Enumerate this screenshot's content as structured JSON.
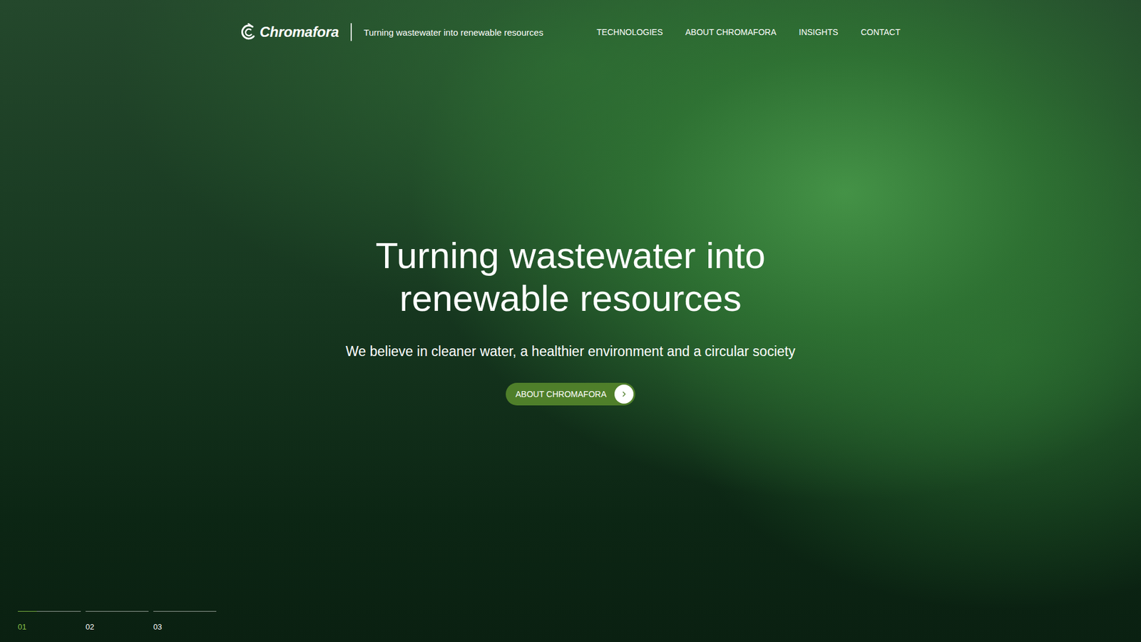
{
  "header": {
    "logo": "Chromafora",
    "tagline": "Turning wastewater into renewable resources"
  },
  "nav": [
    {
      "label": "TECHNOLOGIES"
    },
    {
      "label": "ABOUT CHROMAFORA"
    },
    {
      "label": "INSIGHTS"
    },
    {
      "label": "CONTACT"
    }
  ],
  "hero": {
    "title_lines": [
      "Turning wastewater into",
      "renewable resources"
    ],
    "subtitle": "We believe in cleaner water, a healthier environment and a circular society",
    "button": "ABOUT CHROMAFORA"
  },
  "slides": [
    {
      "label": "01",
      "selected": true,
      "level": 0.3
    },
    {
      "label": "02",
      "selected": false,
      "level": 0
    },
    {
      "label": "03",
      "selected": false,
      "level": 0
    }
  ]
}
